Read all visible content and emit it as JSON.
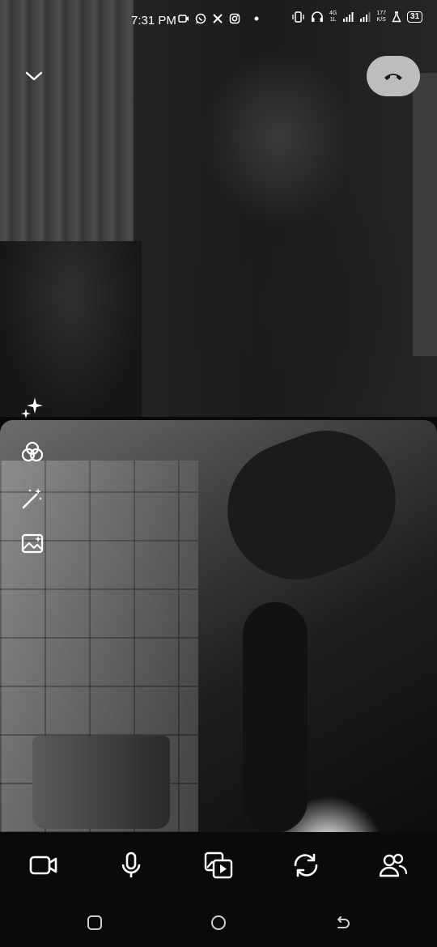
{
  "status_bar": {
    "time": "7:31 PM",
    "network_label": "4G",
    "network_sub": "1L",
    "speed_value": "177",
    "speed_unit": "K/S",
    "battery": "31",
    "app_icons": [
      "video-recorder-icon",
      "whatsapp-icon",
      "x-icon",
      "instagram-icon",
      "dot-icon"
    ],
    "right_icons": [
      "vibrate-icon",
      "headphones-icon",
      "signal-icon",
      "signal-icon",
      "flask-icon",
      "battery-icon"
    ]
  },
  "top_controls": {
    "collapse_icon": "chevron-down-icon",
    "end_call_icon": "phone-hangup-icon",
    "end_call_color": "#bdbdbd"
  },
  "side_tools": [
    "sparkles-icon",
    "filters-icon",
    "magic-wand-icon",
    "background-image-icon"
  ],
  "call_controls": [
    "camera-icon",
    "microphone-icon",
    "media-share-icon",
    "switch-camera-icon",
    "participants-icon"
  ],
  "nav_bar": [
    "recents-icon",
    "home-icon",
    "back-icon"
  ],
  "colors": {
    "background": "#0a0a0a",
    "icon": "#ffffff"
  }
}
